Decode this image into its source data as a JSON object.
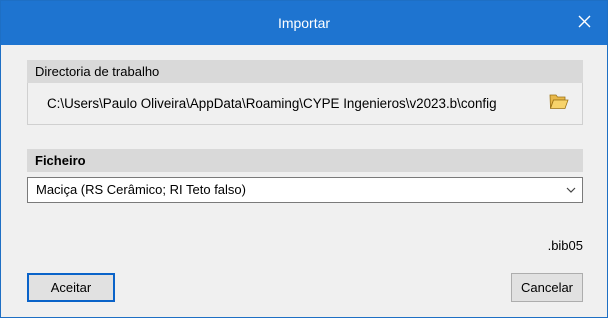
{
  "dialog": {
    "title": "Importar",
    "close_icon": "close-icon",
    "titlebar_color": "#1e74d0"
  },
  "working_dir": {
    "header": "Directoria de trabalho",
    "path": "C:\\Users\\Paulo Oliveira\\AppData\\Roaming\\CYPE Ingenieros\\v2023.b\\config",
    "browse_icon": "folder-open-icon"
  },
  "file": {
    "header": "Ficheiro",
    "selected": "Maciça (RS Cerâmico; RI Teto falso)",
    "extension": ".bib05"
  },
  "buttons": {
    "ok": "Aceitar",
    "cancel": "Cancelar"
  }
}
